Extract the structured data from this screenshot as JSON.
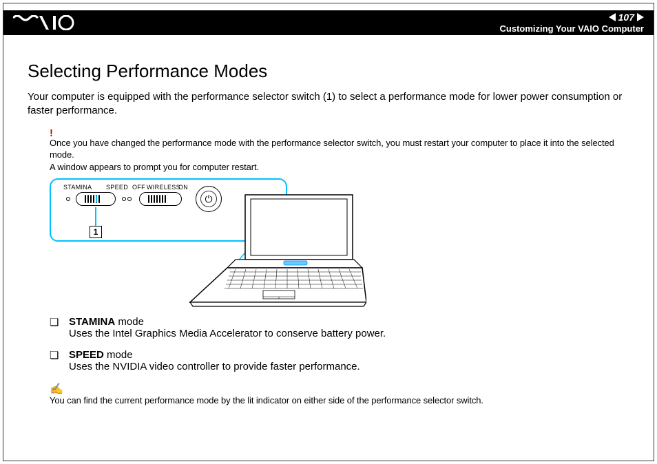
{
  "header": {
    "page_number": "107",
    "section_title": "Customizing Your VAIO Computer"
  },
  "title": "Selecting Performance Modes",
  "intro": "Your computer is equipped with the performance selector switch (1) to select a performance mode for lower power consumption or faster performance.",
  "warning": {
    "line1": "Once you have changed the performance mode with the performance selector switch, you must restart your computer to place it into the selected mode.",
    "line2": "A window appears to prompt you for computer restart."
  },
  "diagram": {
    "labels": {
      "stamina": "STAMINA",
      "speed": "SPEED",
      "off": "OFF",
      "wireless": "WIRELESS",
      "on": "ON"
    },
    "callout_number": "1"
  },
  "modes": [
    {
      "name": "STAMINA",
      "suffix": " mode",
      "description": "Uses the Intel Graphics Media Accelerator to conserve battery power."
    },
    {
      "name": "SPEED",
      "suffix": " mode",
      "description": "Uses the NVIDIA video controller to provide faster performance."
    }
  ],
  "note": "You can find the current performance mode by the lit indicator on either side of the performance selector switch."
}
